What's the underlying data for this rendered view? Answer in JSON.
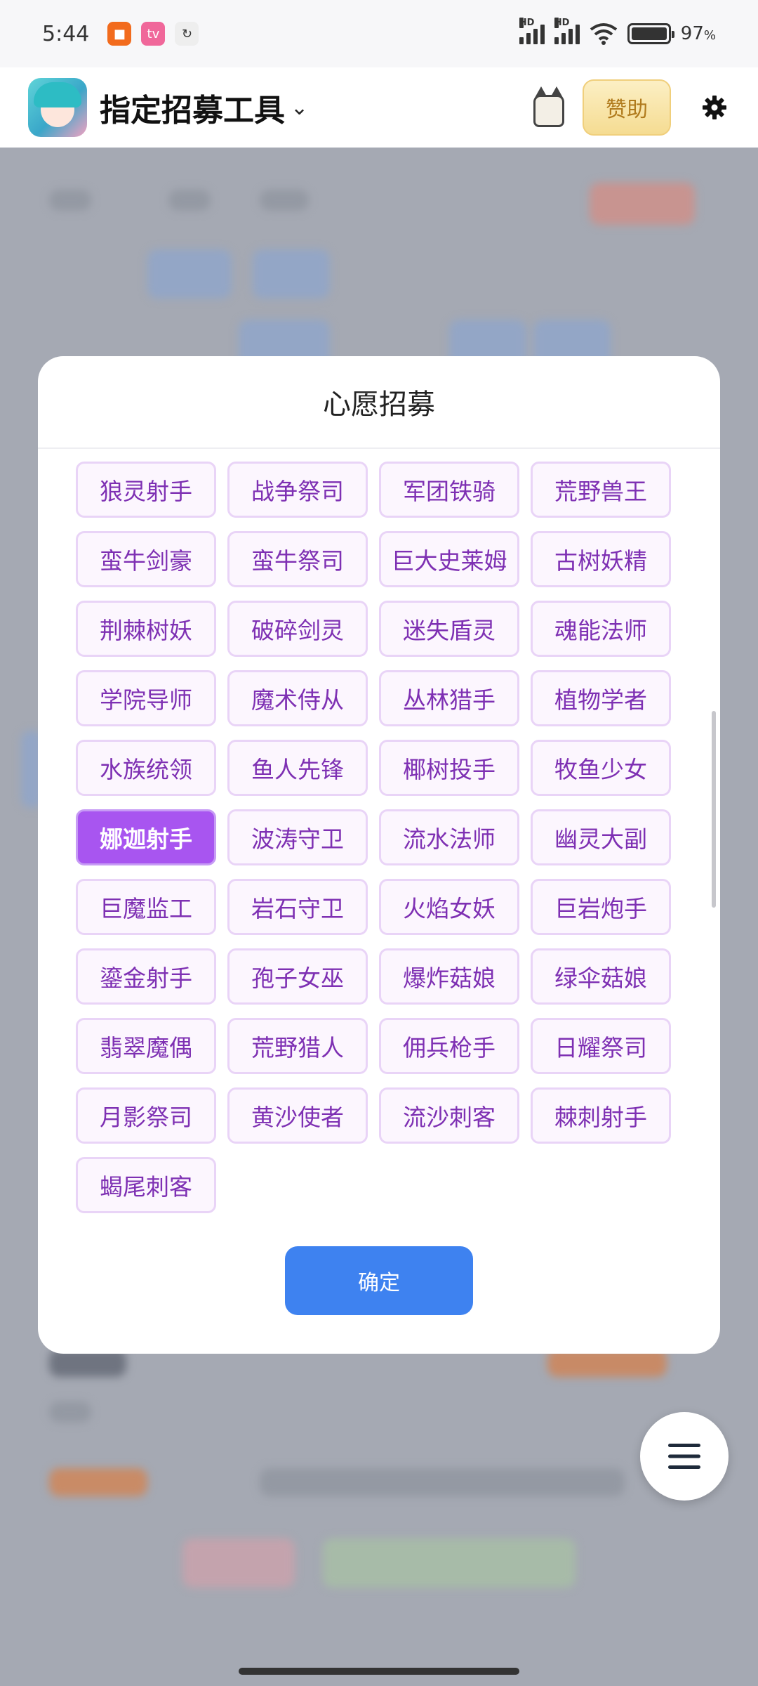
{
  "status_bar": {
    "time": "5:44",
    "hd_label": "HD",
    "battery": "97",
    "battery_unit": "%",
    "notification_icons": [
      "video-app-icon",
      "bilibili-icon",
      "sync-app-icon"
    ]
  },
  "app_bar": {
    "title": "指定招募工具",
    "chevron": "⌄",
    "sponsor_label": "赞助",
    "icons": [
      "app-logo",
      "pixel-cat-icon",
      "gear-icon"
    ]
  },
  "modal": {
    "title": "心愿招募",
    "selected": "娜迦射手",
    "options": [
      "狼灵射手",
      "战争祭司",
      "军团铁骑",
      "荒野兽王",
      "蛮牛剑豪",
      "蛮牛祭司",
      "巨大史莱姆",
      "古树妖精",
      "荆棘树妖",
      "破碎剑灵",
      "迷失盾灵",
      "魂能法师",
      "学院导师",
      "魔术侍从",
      "丛林猎手",
      "植物学者",
      "水族统领",
      "鱼人先锋",
      "椰树投手",
      "牧鱼少女",
      "娜迦射手",
      "波涛守卫",
      "流水法师",
      "幽灵大副",
      "巨魔监工",
      "岩石守卫",
      "火焰女妖",
      "巨岩炮手",
      "鎏金射手",
      "孢子女巫",
      "爆炸菇娘",
      "绿伞菇娘",
      "翡翠魔偶",
      "荒野猎人",
      "佣兵枪手",
      "日耀祭司",
      "月影祭司",
      "黄沙使者",
      "流沙刺客",
      "棘刺射手",
      "蝎尾刺客"
    ],
    "confirm_label": "确定"
  },
  "colors": {
    "accent_blue": "#3e82f0",
    "chip_text": "#7e30b3",
    "chip_selected_bg": "#a855f0"
  }
}
